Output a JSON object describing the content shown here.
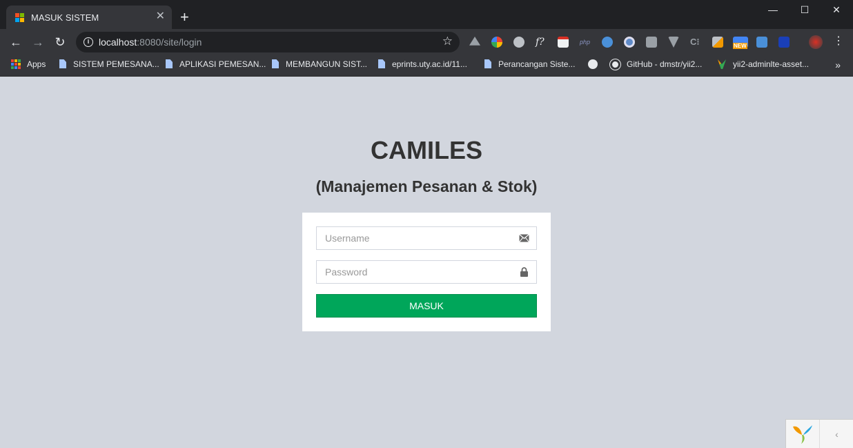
{
  "browser": {
    "tab": {
      "title": "MASUK SISTEM"
    },
    "url_host": "localhost",
    "url_path": ":8080/site/login",
    "bookmarks": [
      {
        "label": "Apps",
        "icon": "apps-grid-icon"
      },
      {
        "label": "SISTEM PEMESANA...",
        "icon": "doc-icon"
      },
      {
        "label": "APLIKASI PEMESAN...",
        "icon": "doc-icon"
      },
      {
        "label": "MEMBANGUN SIST...",
        "icon": "doc-icon"
      },
      {
        "label": "eprints.uty.ac.id/11...",
        "icon": "doc-icon"
      },
      {
        "label": "Perancangan Siste...",
        "icon": "doc-icon"
      },
      {
        "label": "",
        "icon": "globe-icon"
      },
      {
        "label": "GitHub - dmstr/yii2...",
        "icon": "github-icon"
      },
      {
        "label": "yii2-adminlte-asset...",
        "icon": "yii-icon"
      }
    ],
    "bookmarks_more": "»",
    "extensions_badge": "NEW"
  },
  "login": {
    "title": "CAMILES",
    "subtitle": "(Manajemen Pesanan & Stok)",
    "username_placeholder": "Username",
    "password_placeholder": "Password",
    "submit_label": "MASUK"
  },
  "colors": {
    "page_bg": "#d2d6de",
    "submit_bg": "#00a65a",
    "chrome_dark": "#202124",
    "chrome_toolbar": "#35363a"
  }
}
